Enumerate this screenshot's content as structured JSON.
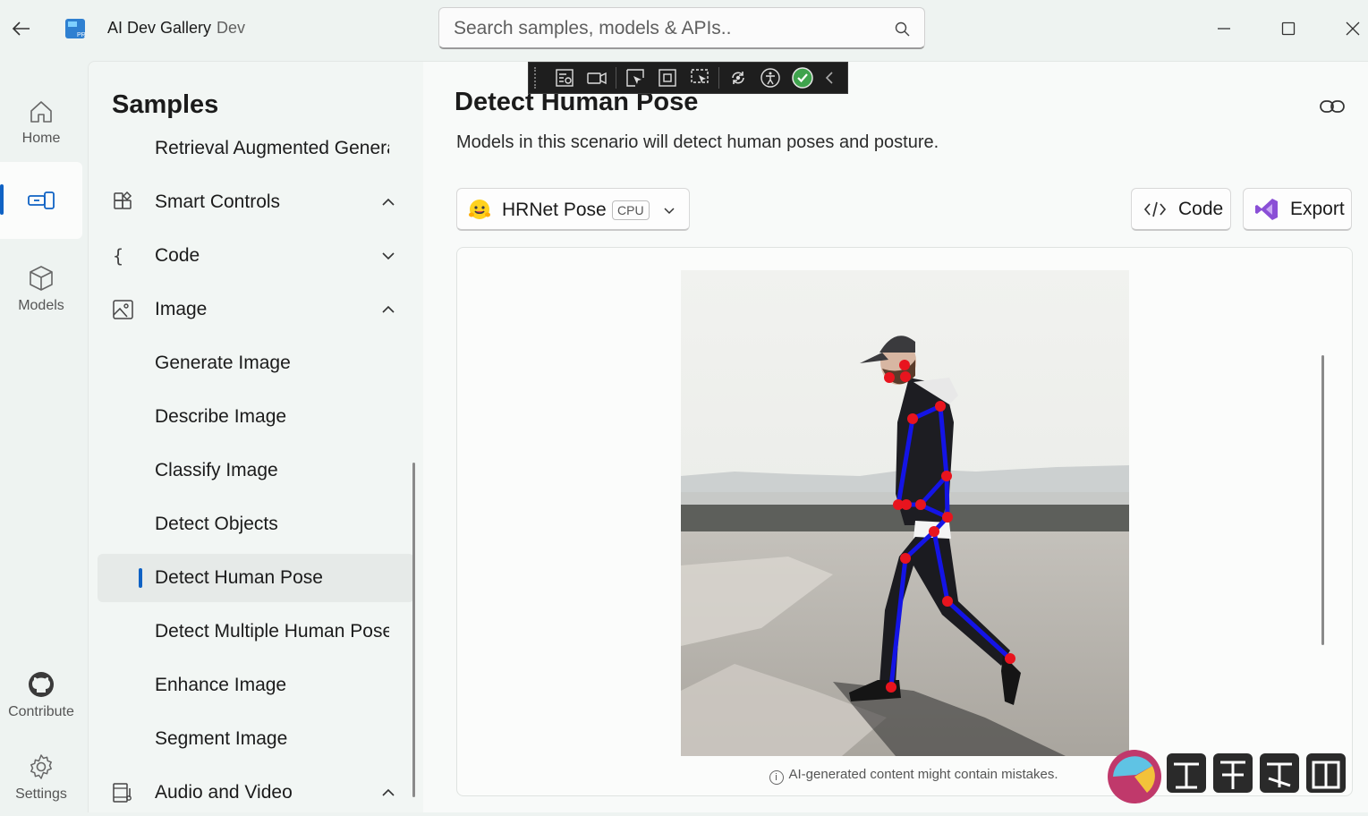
{
  "app": {
    "title": "AI Dev Gallery",
    "badge": "Dev"
  },
  "search": {
    "placeholder": "Search samples, models & APIs.."
  },
  "rail": {
    "home": "Home",
    "models": "Models",
    "contribute": "Contribute",
    "settings": "Settings"
  },
  "samples": {
    "title": "Samples",
    "items": [
      {
        "label": "Retrieval Augmented Generation"
      },
      {
        "label": "Smart Controls",
        "icon": "smart-controls-icon",
        "expanded": true
      },
      {
        "label": "Code",
        "icon": "braces-icon",
        "expanded": false
      },
      {
        "label": "Image",
        "icon": "image-icon",
        "expanded": true
      },
      {
        "label": "Generate Image"
      },
      {
        "label": "Describe Image"
      },
      {
        "label": "Classify Image"
      },
      {
        "label": "Detect Objects"
      },
      {
        "label": "Detect Human Pose",
        "selected": true
      },
      {
        "label": "Detect Multiple Human Poses"
      },
      {
        "label": "Enhance Image"
      },
      {
        "label": "Segment Image"
      },
      {
        "label": "Audio and Video",
        "icon": "audio-video-icon",
        "expanded": true
      }
    ]
  },
  "page": {
    "title": "Detect Human Pose",
    "description": "Models in this scenario will detect human poses and posture."
  },
  "model_picker": {
    "name": "HRNet Pose",
    "device": "CPU",
    "icon": "hugging-face-icon"
  },
  "actions": {
    "code": "Code",
    "export": "Export"
  },
  "output": {
    "disclaimer": "AI-generated content might contain mistakes."
  },
  "colors": {
    "accent": "#0f62c4",
    "skeleton_line": "#1414e6",
    "keypoint": "#e8141e"
  }
}
